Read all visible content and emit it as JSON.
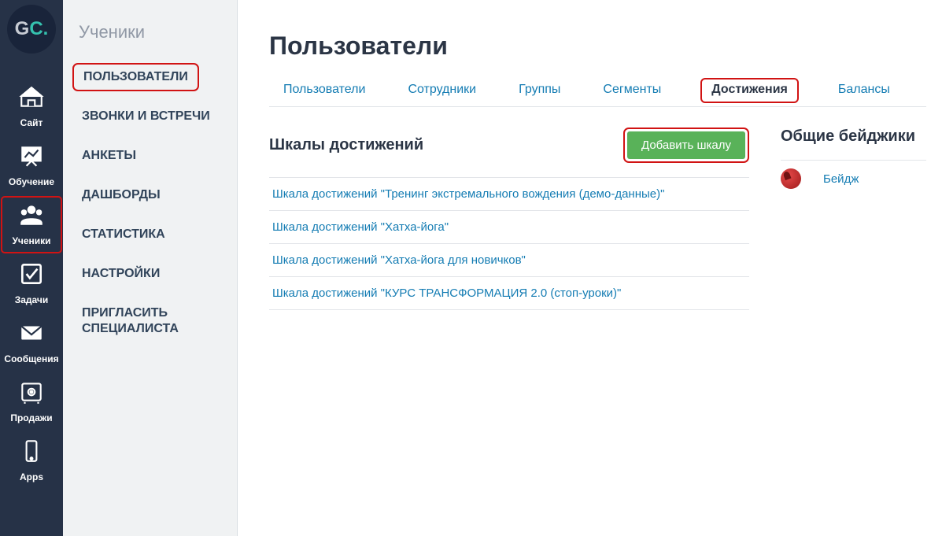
{
  "logo_text": {
    "g": "G",
    "c": "C."
  },
  "main_nav": [
    {
      "id": "site",
      "label": "Сайт"
    },
    {
      "id": "learning",
      "label": "Обучение"
    },
    {
      "id": "students",
      "label": "Ученики",
      "highlight": true
    },
    {
      "id": "tasks",
      "label": "Задачи"
    },
    {
      "id": "messages",
      "label": "Сообщения"
    },
    {
      "id": "sales",
      "label": "Продажи"
    },
    {
      "id": "apps",
      "label": "Apps"
    }
  ],
  "sub_nav": {
    "title": "Ученики",
    "items": [
      {
        "label": "ПОЛЬЗОВАТЕЛИ",
        "highlight": true
      },
      {
        "label": "ЗВОНКИ И ВСТРЕЧИ"
      },
      {
        "label": "АНКЕТЫ"
      },
      {
        "label": "ДАШБОРДЫ"
      },
      {
        "label": "СТАТИСТИКА"
      },
      {
        "label": "НАСТРОЙКИ"
      },
      {
        "label": "ПРИГЛАСИТЬ СПЕЦИАЛИСТА"
      }
    ]
  },
  "page": {
    "title": "Пользователи",
    "tabs": [
      {
        "label": "Пользователи"
      },
      {
        "label": "Сотрудники"
      },
      {
        "label": "Группы"
      },
      {
        "label": "Сегменты"
      },
      {
        "label": "Достижения",
        "active": true
      },
      {
        "label": "Балансы"
      }
    ],
    "scales": {
      "heading": "Шкалы достижений",
      "add_button": "Добавить шкалу",
      "items": [
        "Шкала достижений \"Тренинг экстремального вождения (демо-данные)\"",
        "Шкала достижений \"Хатха-йога\"",
        "Шкала достижений \"Хатха-йога для новичков\"",
        "Шкала достижений \"КУРС ТРАНСФОРМАЦИЯ 2.0 (стоп-уроки)\""
      ]
    },
    "badges": {
      "heading": "Общие бейджики",
      "items": [
        {
          "label": "Бейдж"
        }
      ]
    }
  }
}
